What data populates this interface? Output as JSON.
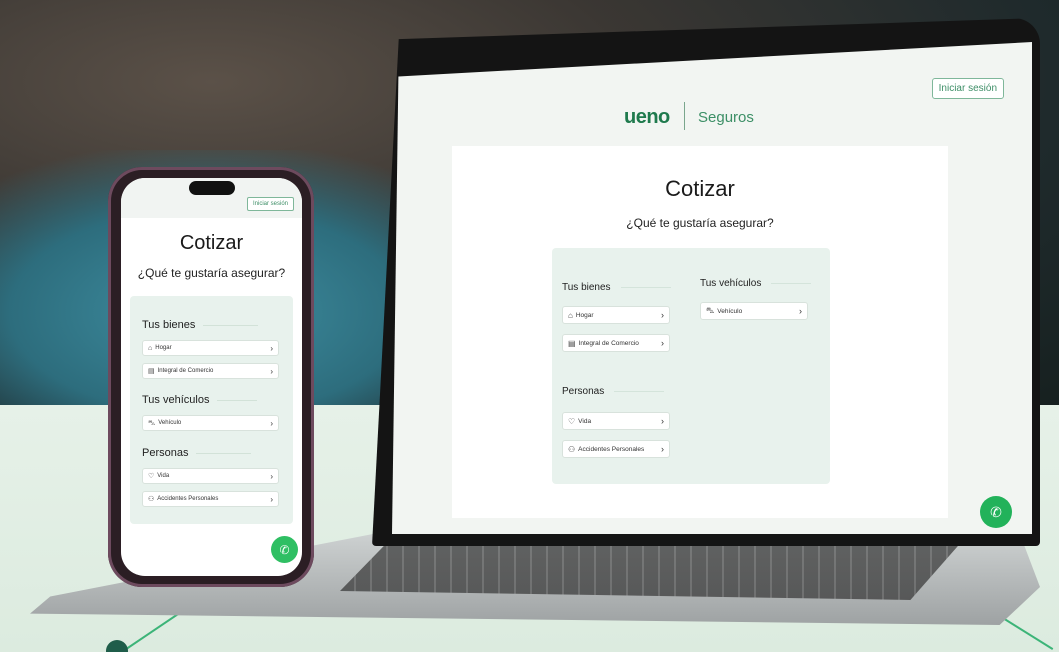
{
  "laptop": {
    "login_button": "Iniciar sesión",
    "brand_logo": "ueno",
    "brand_suffix": "Seguros",
    "title": "Cotizar",
    "subtitle": "¿Qué te gustaría asegurar?",
    "sections": {
      "bienes": {
        "label": "Tus bienes",
        "items": [
          "Hogar",
          "Integral de Comercio"
        ]
      },
      "vehiculos": {
        "label": "Tus vehículos",
        "items": [
          "Vehículo"
        ]
      },
      "personas": {
        "label": "Personas",
        "items": [
          "Vida",
          "Accidentes Personales"
        ]
      }
    }
  },
  "phone": {
    "login_button": "Iniciar sesión",
    "title": "Cotizar",
    "subtitle": "¿Qué te gustaría asegurar?",
    "sections": {
      "bienes": {
        "label": "Tus bienes",
        "items": [
          "Hogar",
          "Integral de Comercio"
        ]
      },
      "vehiculos": {
        "label": "Tus vehículos",
        "items": [
          "Vehículo"
        ]
      },
      "personas": {
        "label": "Personas",
        "items": [
          "Vida",
          "Accidentes Personales"
        ]
      }
    }
  },
  "icons": {
    "home": "home-icon",
    "store": "store-icon",
    "car": "car-icon",
    "heart": "heart-icon",
    "person": "person-icon",
    "chevron": "chevron-right-icon",
    "whatsapp": "whatsapp-icon"
  },
  "colors": {
    "brand_green": "#1f7a4d",
    "whatsapp_green": "#22b25a",
    "panel_mint": "#e8f2ed",
    "background_mint": "#dfeee3"
  }
}
